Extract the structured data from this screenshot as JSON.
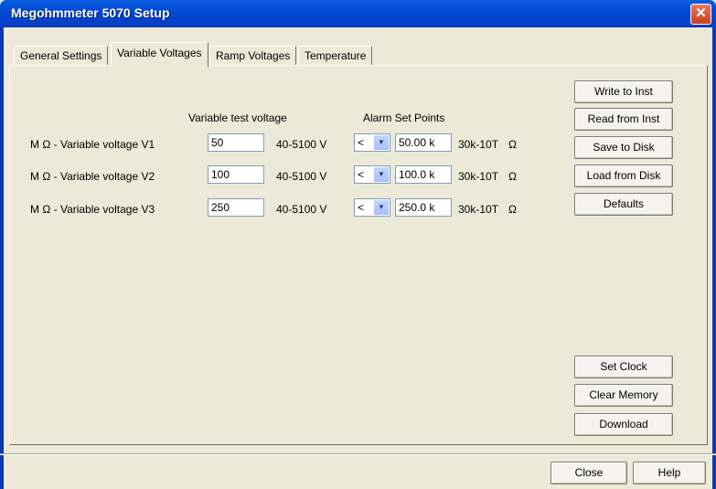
{
  "window": {
    "title": "Megohmmeter 5070 Setup",
    "close_glyph": "✕"
  },
  "tabs": [
    "General Settings",
    "Variable Voltages",
    "Ramp Voltages",
    "Temperature"
  ],
  "active_tab": "Variable Voltages",
  "headers": {
    "test_voltage": "Variable test voltage",
    "alarm": "Alarm Set Points"
  },
  "rows": [
    {
      "label": "M Ω - Variable voltage  V1",
      "voltage": "50",
      "range": "40-5100 V",
      "comparator": "<",
      "alarm": "50.00 k",
      "alarm_range": "30k-10T",
      "unit": "Ω"
    },
    {
      "label": "M Ω - Variable voltage  V2",
      "voltage": "100",
      "range": "40-5100 V",
      "comparator": "<",
      "alarm": "100.0 k",
      "alarm_range": "30k-10T",
      "unit": "Ω"
    },
    {
      "label": "M Ω - Variable voltage  V3",
      "voltage": "250",
      "range": "40-5100 V",
      "comparator": "<",
      "alarm": "250.0 k",
      "alarm_range": "30k-10T",
      "unit": "Ω"
    }
  ],
  "side_buttons": [
    "Write to Inst",
    "Read from Inst",
    "Save to Disk",
    "Load from Disk",
    "Defaults"
  ],
  "lower_buttons": [
    "Set Clock",
    "Clear Memory",
    "Download"
  ],
  "footer": {
    "close": "Close",
    "help": "Help"
  },
  "colors": {
    "titlebar": "#0449d6",
    "face": "#ece9d8",
    "close_button": "#c9401a"
  }
}
